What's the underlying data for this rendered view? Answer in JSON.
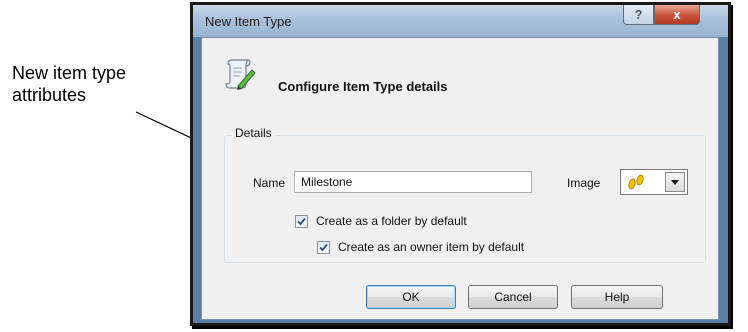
{
  "callout": {
    "line1": "New item type",
    "line2": "attributes"
  },
  "window": {
    "title": "New Item Type",
    "help_glyph": "?",
    "close_glyph": "x"
  },
  "header": {
    "icon": "scroll-pen-icon",
    "title": "Configure Item Type details"
  },
  "details": {
    "legend": "Details",
    "name_label": "Name",
    "name_value": "Milestone",
    "image_label": "Image",
    "image_icon": "footprints-icon",
    "folder_checkbox": {
      "label": "Create as a folder by default",
      "checked": true
    },
    "owner_checkbox": {
      "label": "Create as an owner item by default",
      "checked": true
    }
  },
  "buttons": {
    "ok": "OK",
    "cancel": "Cancel",
    "help": "Help"
  },
  "colors": {
    "titlebar": "#a9c1db",
    "close": "#c8533a",
    "client": "#f0f0f0",
    "default_button_border": "#3c7fb1",
    "footprints": "#f2c200"
  }
}
